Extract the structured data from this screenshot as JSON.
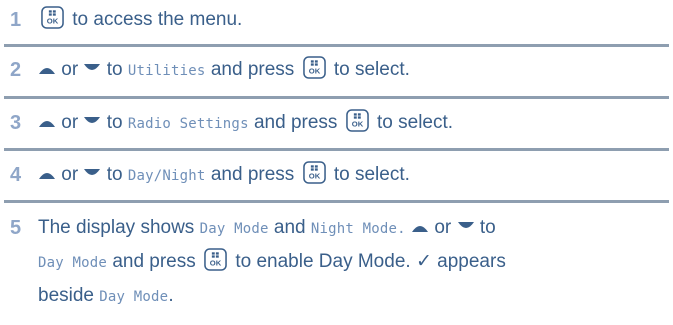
{
  "steps": [
    {
      "number": "1",
      "text_after_key": "to access the menu."
    },
    {
      "number": "2",
      "or": "or",
      "to": "to",
      "target": "Utilities",
      "and_press": "and press",
      "after": "to select."
    },
    {
      "number": "3",
      "or": "or",
      "to": "to",
      "target": "Radio Settings",
      "and_press": "and press",
      "after": "to select."
    },
    {
      "number": "4",
      "or": "or",
      "to": "to",
      "target": "Day/Night",
      "and_press": "and press",
      "after": "to select."
    },
    {
      "number": "5",
      "lead": "The display shows",
      "option1": "Day Mode",
      "and": "and",
      "option2": "Night Mode.",
      "or": "or",
      "to": "to",
      "target": "Day Mode",
      "and_press": "and press",
      "enable": "to enable Day Mode.",
      "check": "✓",
      "appears": "appears",
      "beside": "beside",
      "beside_target": "Day Mode",
      "period": "."
    }
  ],
  "icons": {
    "ok_key": "ok-menu-key-icon",
    "up": "up-arrow-icon",
    "down": "down-arrow-icon"
  },
  "colors": {
    "text": "#3a5f8a",
    "number": "#8fa6c8",
    "mono": "#6f8fb8",
    "separator": "#8e9eb0"
  }
}
